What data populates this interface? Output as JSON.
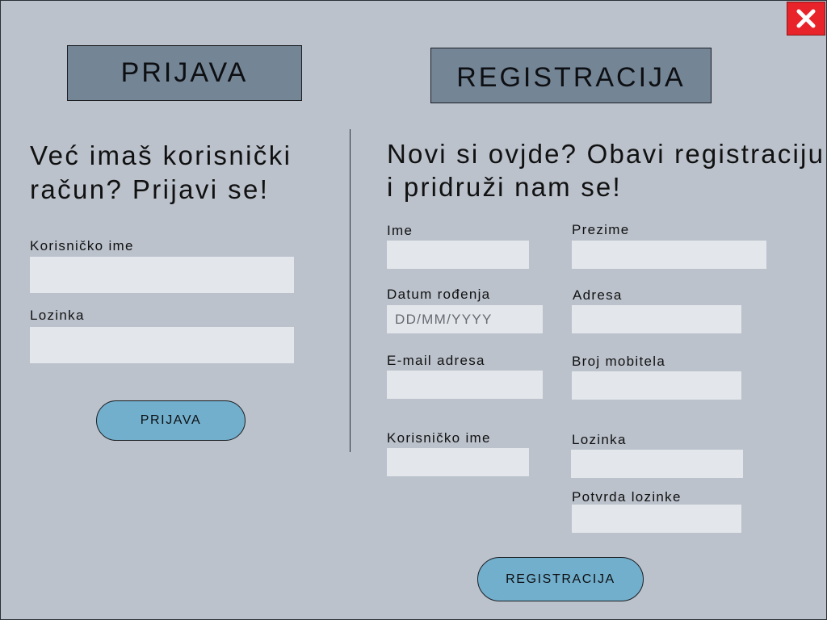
{
  "header": {
    "login_tab": "PRIJAVA",
    "register_tab": "REGISTRACIJA"
  },
  "login": {
    "heading": "Već imaš korisnički račun? Prijavi se!",
    "username_label": "Korisničko ime",
    "username_value": "",
    "password_label": "Lozinka",
    "password_value": "",
    "submit_label": "PRIJAVA"
  },
  "register": {
    "heading": "Novi si ovjde? Obavi registraciju i pridruži nam se!",
    "first_name_label": "Ime",
    "last_name_label": "Prezime",
    "birth_date_label": "Datum rođenja",
    "birth_date_placeholder": "DD/MM/YYYY",
    "address_label": "Adresa",
    "email_label": "E-mail adresa",
    "phone_label": "Broj mobitela",
    "username_label": "Korisničko ime",
    "password_label": "Lozinka",
    "confirm_password_label": "Potvrda lozinke",
    "submit_label": "REGISTRACIJA"
  },
  "window": {
    "close_icon": "close-x-icon"
  },
  "colors": {
    "background": "#bbc2cc",
    "header_box": "#748596",
    "input_bg": "#e3e6ea",
    "button_bg": "#72afcc",
    "close_bg": "#e8232a"
  }
}
